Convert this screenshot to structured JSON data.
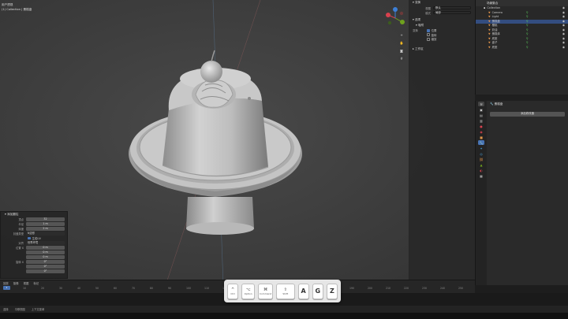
{
  "viewport": {
    "info_line1": "用户透视",
    "info_line2": "(1) Collection | 蛋糕盘"
  },
  "npanel": {
    "section_transform": "变换",
    "row_viewpoint_label": "视图",
    "row_viewpoint_value": "默认",
    "row_mode_label": "模式",
    "row_mode_value": "局部",
    "section_options": "选项",
    "subsection_snap": "吸附",
    "check_label": "变换",
    "check_items": [
      "位置",
      "旋转",
      "缩放"
    ],
    "section_workspace": "工作区"
  },
  "outliner": {
    "title": "场景集合",
    "items": [
      {
        "name": "Collection",
        "selected": false
      },
      {
        "name": "Camera",
        "selected": false
      },
      {
        "name": "Light",
        "selected": false
      },
      {
        "name": "蛋糕盘",
        "selected": true
      },
      {
        "name": "樱桃",
        "selected": false
      },
      {
        "name": "奶油",
        "selected": false
      },
      {
        "name": "蛋糕体",
        "selected": false
      },
      {
        "name": "底座",
        "selected": false
      },
      {
        "name": "盘子",
        "selected": false
      },
      {
        "name": "底座",
        "selected": false
      }
    ]
  },
  "properties": {
    "title": "蛋糕盘",
    "add_modifier": "添加修改器"
  },
  "op_panel": {
    "title": "添加圆柱",
    "rows": [
      {
        "label": "顶点",
        "value": "32"
      },
      {
        "label": "半径",
        "value": "1 m"
      },
      {
        "label": "深度",
        "value": "2 m"
      },
      {
        "label": "封盖类型",
        "value": "N边形"
      }
    ],
    "check": "生成UV",
    "align_label": "对齐",
    "align_value": "世界环境",
    "location_label": "位置 X",
    "location_values": [
      "0 m",
      "0 m",
      "0 m"
    ],
    "rotation_label": "旋转 X",
    "rotation_values": [
      "0°",
      "0°",
      "0°"
    ]
  },
  "timeline": {
    "menu": [
      "回放",
      "抠像",
      "视图",
      "标记"
    ],
    "ticks": [
      "0",
      "10",
      "20",
      "30",
      "40",
      "50",
      "60",
      "70",
      "80",
      "90",
      "100",
      "110",
      "120",
      "130",
      "140",
      "150",
      "160",
      "170",
      "180",
      "190",
      "200",
      "210",
      "220",
      "230",
      "240",
      "250"
    ],
    "current_frame": "1"
  },
  "status": {
    "items": [
      "选择",
      "平移视图",
      "上下文菜单"
    ]
  },
  "key_overlay": {
    "keys": [
      {
        "sym": "^",
        "label": "Ctrl"
      },
      {
        "sym": "⌥",
        "label": "Option"
      },
      {
        "sym": "⌘",
        "label": "Command"
      },
      {
        "sym": "⇧",
        "label": "Shift"
      },
      {
        "big": "A"
      },
      {
        "big": "G"
      },
      {
        "big": "Z"
      }
    ]
  },
  "colors": {
    "accent": "#4772b3",
    "selection": "#334d80",
    "axis_red": "#d8414e",
    "axis_green": "#6fa11e",
    "axis_blue": "#3d7fd6"
  }
}
